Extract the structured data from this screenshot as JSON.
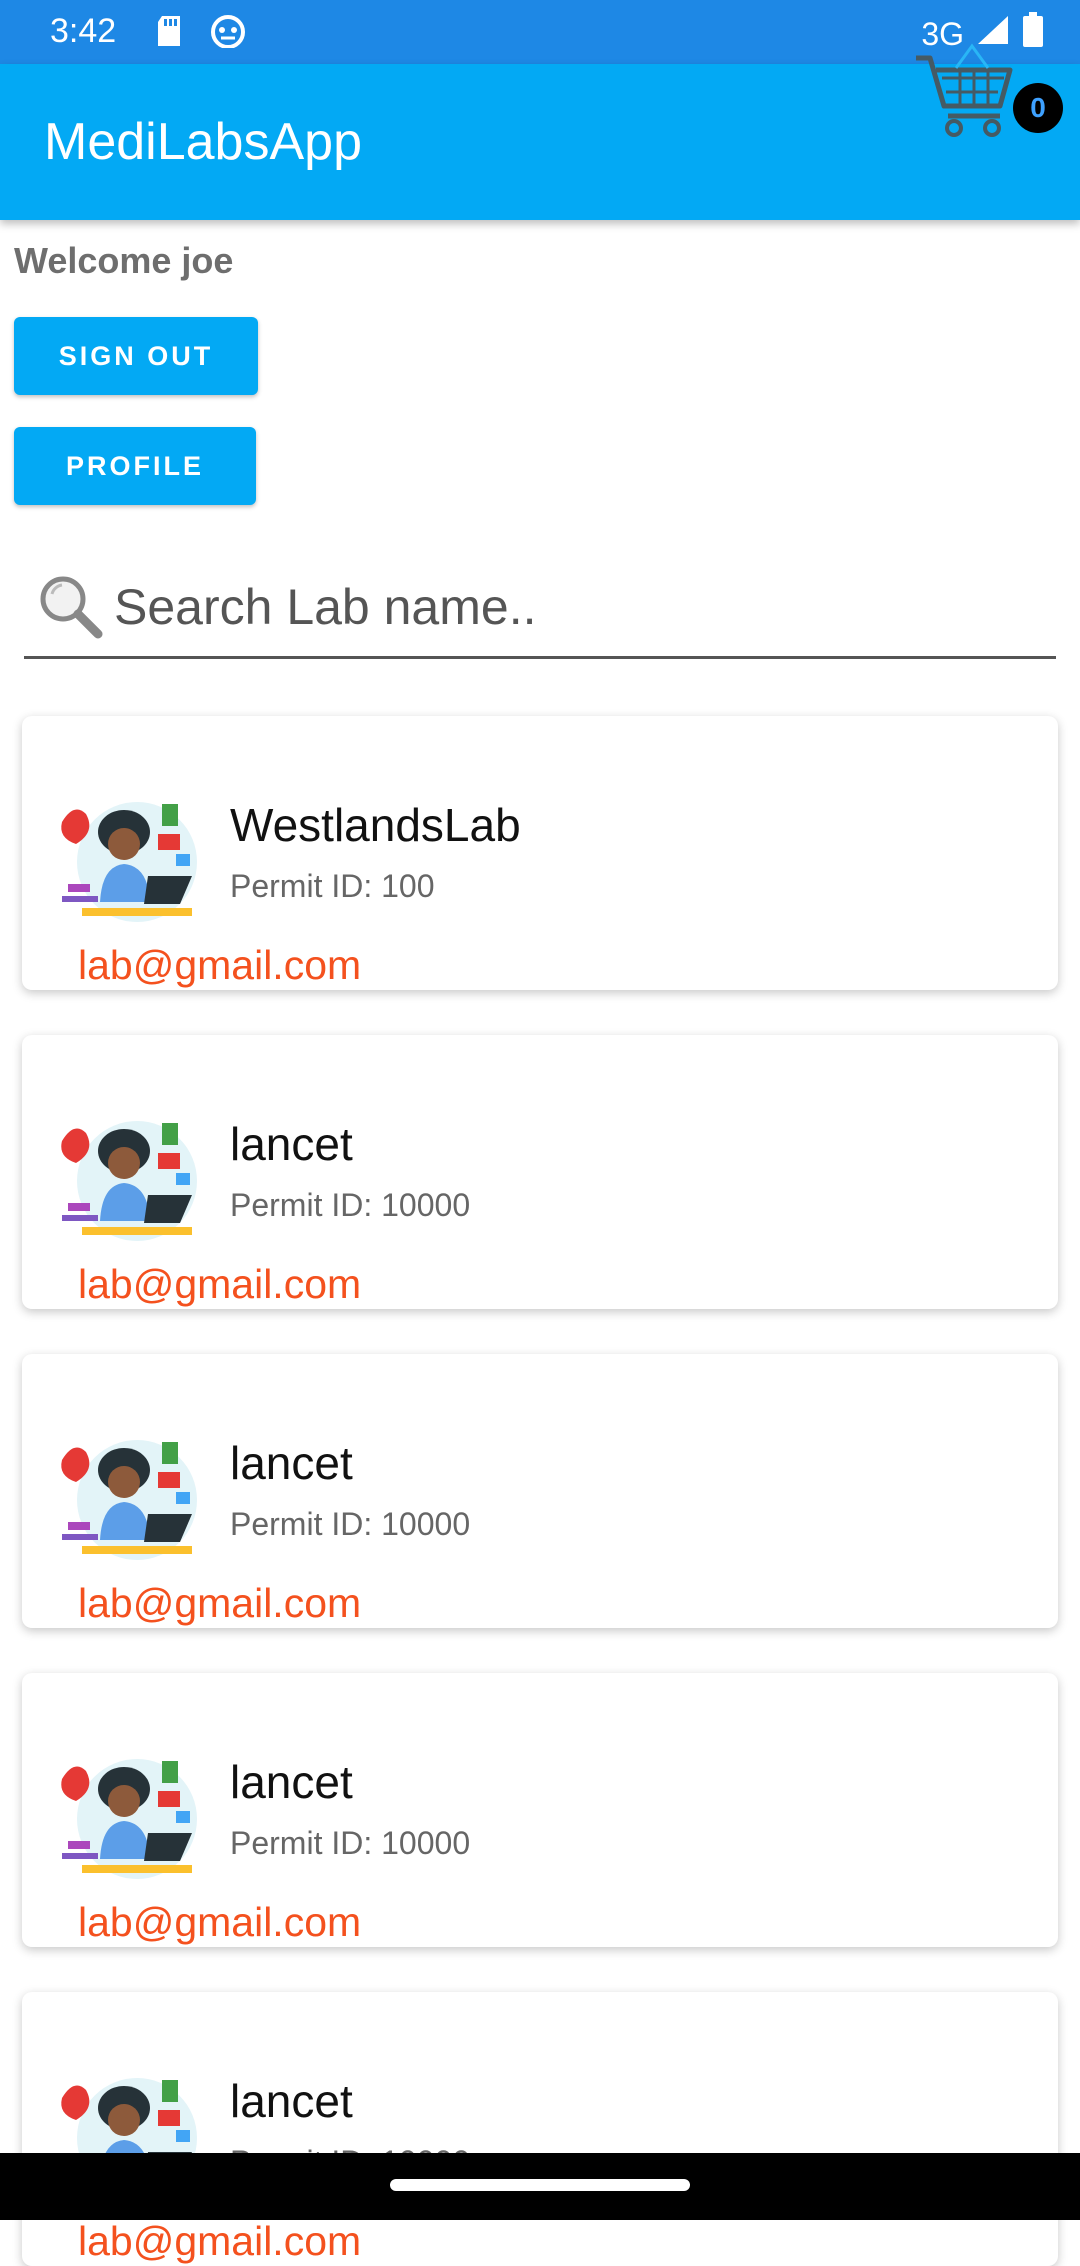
{
  "status_bar": {
    "time": "3:42",
    "network": "3G"
  },
  "app_bar": {
    "title": "MediLabsApp",
    "cart_count": "0"
  },
  "welcome_text": "Welcome joe",
  "buttons": {
    "sign_out": "SIGN OUT",
    "profile": "PROFILE"
  },
  "search": {
    "placeholder": "Search Lab name..",
    "value": ""
  },
  "labs": [
    {
      "name": "WestlandsLab",
      "permit": "Permit ID: 100",
      "email": "lab@gmail.com"
    },
    {
      "name": "lancet",
      "permit": "Permit ID: 10000",
      "email": "lab@gmail.com"
    },
    {
      "name": "lancet",
      "permit": "Permit ID: 10000",
      "email": "lab@gmail.com"
    },
    {
      "name": "lancet",
      "permit": "Permit ID: 10000",
      "email": "lab@gmail.com"
    },
    {
      "name": "lancet",
      "permit": "Permit ID: 10000",
      "email": "lab@gmail.com"
    }
  ],
  "colors": {
    "status_bar": "#1e88e5",
    "app_bar": "#03a9f4",
    "button": "#03a9f4",
    "email": "#f4511e"
  },
  "icons": [
    "sd-card-icon",
    "robot-icon",
    "signal-icon",
    "battery-icon",
    "cart-icon",
    "search-icon",
    "lab-avatar-icon"
  ]
}
